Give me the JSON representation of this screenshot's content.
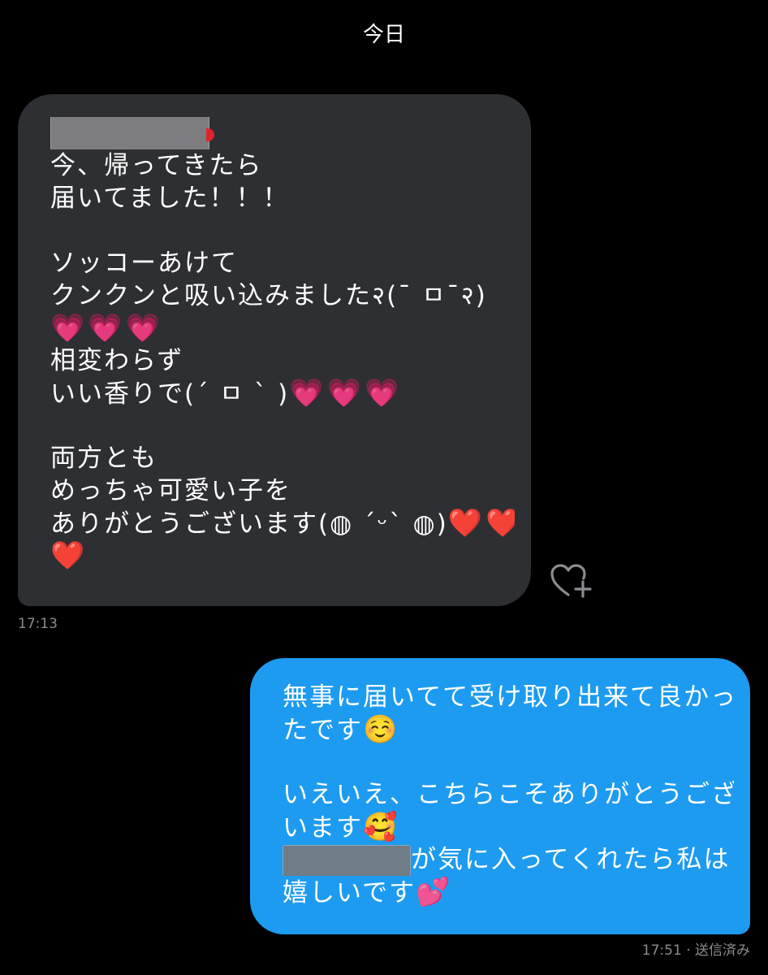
{
  "header": {
    "date_label": "今日"
  },
  "incoming_message": {
    "lines": [
      "今、帰ってきたら",
      "届いてました！！！",
      "",
      "ソッコーあけて",
      "クンクンと吸い込みました२(¯ ㅁ¯२)",
      "",
      "相変わらず",
      "いい香りで(´ ㅁ ` )",
      "",
      "両方とも",
      "めっちゃ可愛い子を",
      "ありがとうございます(◍ ´ᵕ` ◍)"
    ],
    "emoji": {
      "pink_hearts": "💗💗💗",
      "red_hearts": "❤️❤️",
      "red_heart": "❤️"
    },
    "timestamp": "17:13"
  },
  "outgoing_message": {
    "lines": [
      "無事に届いてて受け取り出来て良かっ",
      "たです",
      "",
      "いえいえ、こちらこそありがとうござ",
      "います",
      "が気に入ってくれたら私は",
      "嬉しいです"
    ],
    "emoji": {
      "smiling": "☺️",
      "smiling_hearts": "🥰",
      "two_hearts": "💕"
    },
    "timestamp": "17:51",
    "status": "· 送信済み"
  },
  "colors": {
    "background": "#000000",
    "incoming_bubble": "#2e2f32",
    "outgoing_bubble": "#1d9bf0",
    "timestamp": "#8c8c90"
  },
  "icons": {
    "react": "heart-plus-icon"
  }
}
